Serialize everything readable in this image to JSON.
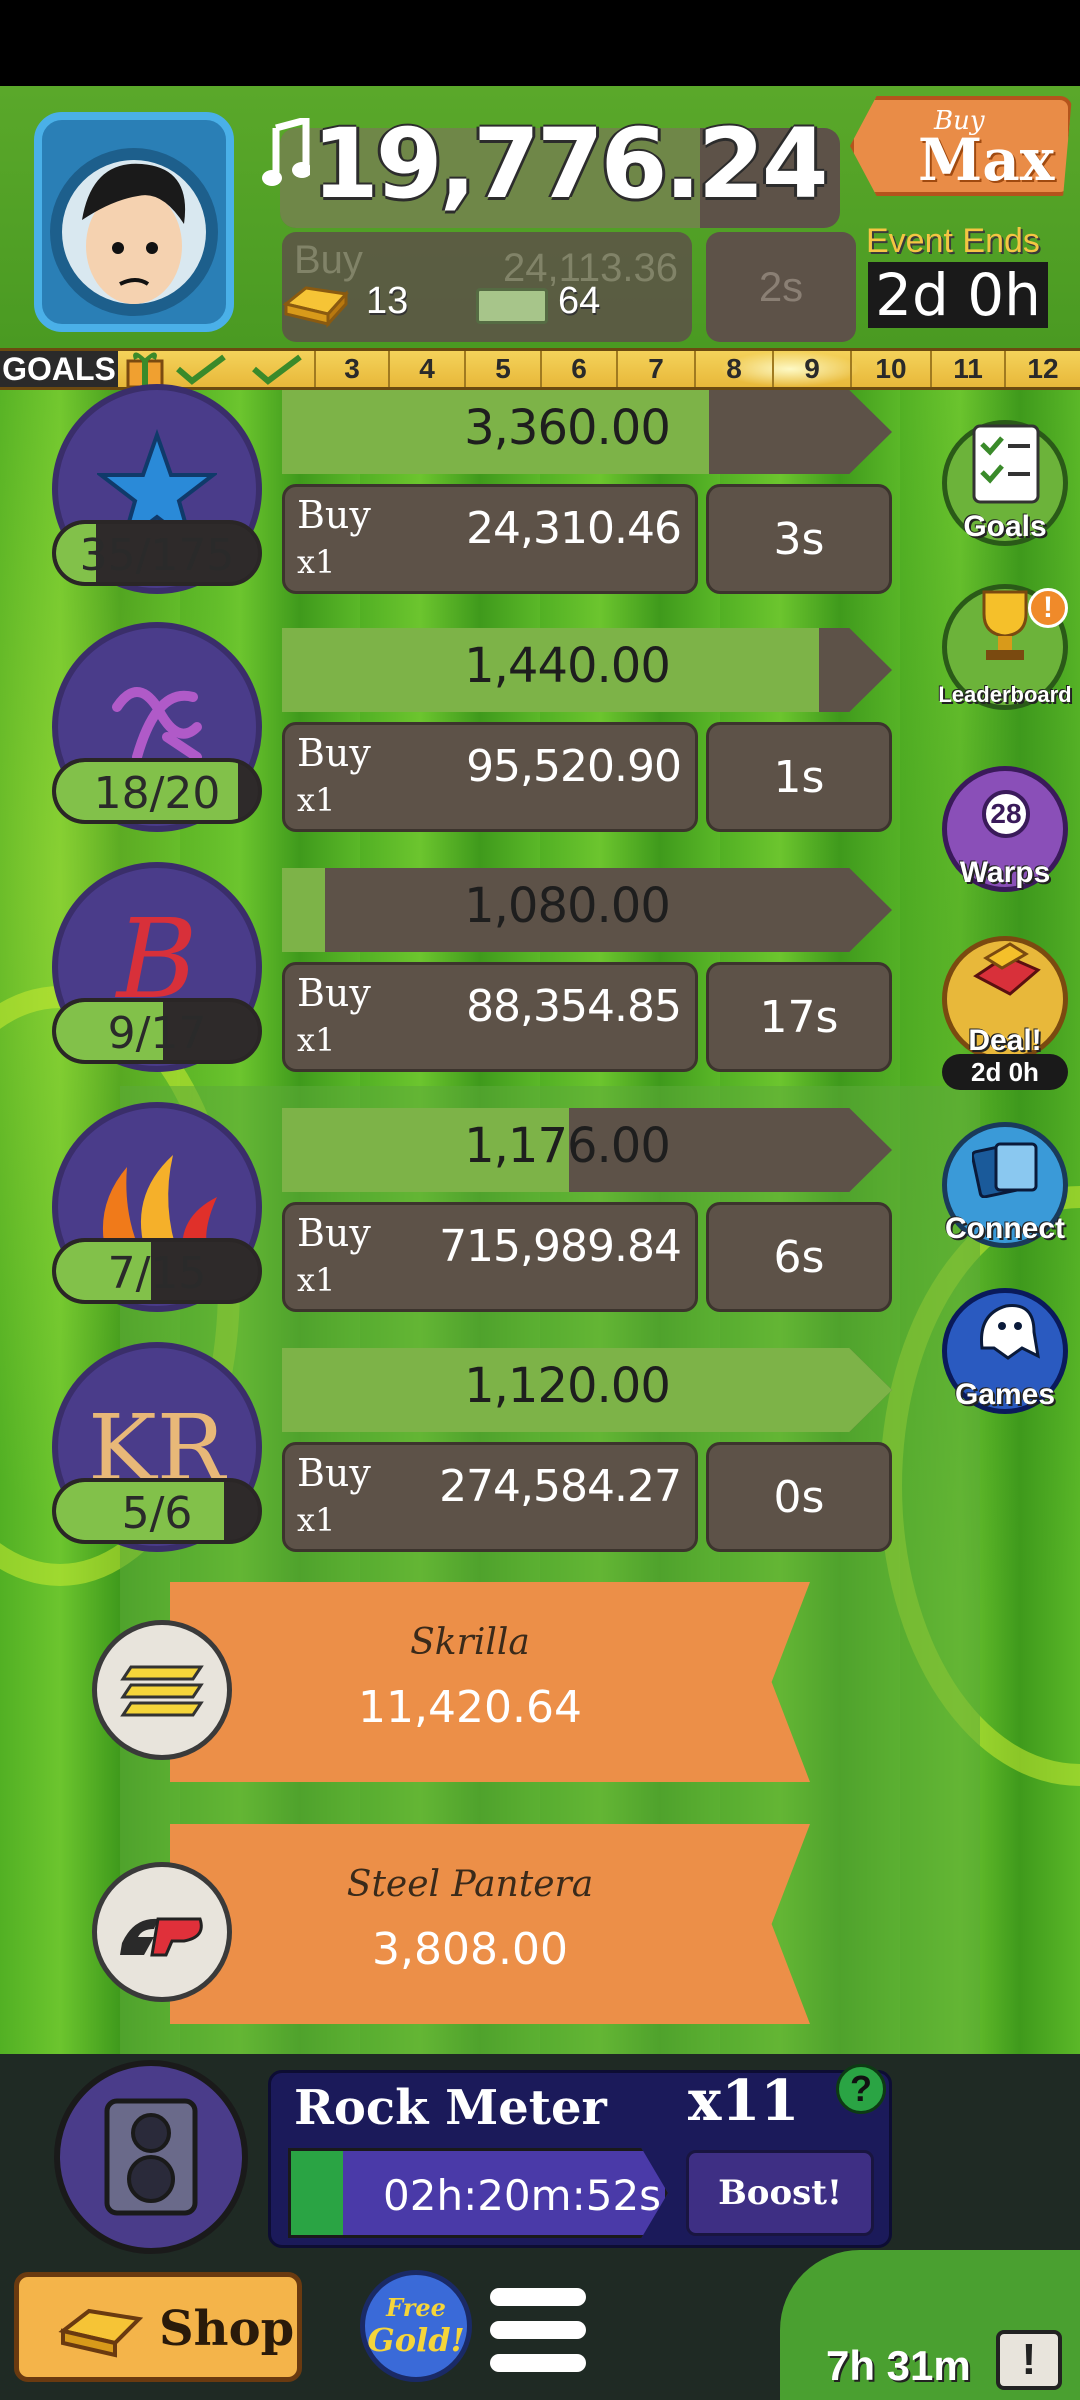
{
  "header": {
    "money": "19,776.24",
    "buy_max_small": "Buy",
    "buy_max_big": "Max",
    "gold_count": "13",
    "bill_count": "64",
    "event_label": "Event Ends in:",
    "event_time": "2d 0h",
    "ghost_buy_label": "Buy",
    "ghost_buy_cost": "24,113.36",
    "ghost_time": "2s"
  },
  "goals": {
    "label": "GOALS",
    "cells": [
      "3",
      "4",
      "5",
      "6",
      "7",
      "8",
      "9",
      "10",
      "11",
      "12"
    ]
  },
  "businesses": [
    {
      "icon": "star-icon",
      "count": "35/175",
      "count_fill": 0.2,
      "progress_value": "3,360.00",
      "progress_fill": 0.7,
      "buy_label": "Buy",
      "buy_qty": "x1",
      "cost": "24,310.46",
      "time": "3s"
    },
    {
      "icon": "curly-symbol-icon",
      "count": "18/20",
      "count_fill": 0.9,
      "progress_value": "1,440.00",
      "progress_fill": 0.88,
      "buy_label": "Buy",
      "buy_qty": "x1",
      "cost": "95,520.90",
      "time": "1s"
    },
    {
      "icon": "gothic-b-icon",
      "count": "9/17",
      "count_fill": 0.53,
      "progress_value": "1,080.00",
      "progress_fill": 0.07,
      "buy_label": "Buy",
      "buy_qty": "x1",
      "cost": "88,354.85",
      "time": "17s"
    },
    {
      "icon": "flame-icon",
      "count": "7/15",
      "count_fill": 0.47,
      "progress_value": "1,176.00",
      "progress_fill": 0.47,
      "buy_label": "Buy",
      "buy_qty": "x1",
      "cost": "715,989.84",
      "time": "6s"
    },
    {
      "icon": "kr-logo-icon",
      "count": "5/6",
      "count_fill": 0.83,
      "progress_value": "1,120.00",
      "progress_fill": 1.0,
      "buy_label": "Buy",
      "buy_qty": "x1",
      "cost": "274,584.27",
      "time": "0s"
    }
  ],
  "side_buttons": [
    {
      "label": "Goals",
      "icon": "checklist-icon",
      "color": "#6cb33a"
    },
    {
      "label": "Leaderboard",
      "icon": "trophy-icon",
      "color": "#6cb33a"
    },
    {
      "label": "Warps",
      "icon": "warp-icon",
      "color": "#8a4fb8",
      "badge": "28"
    },
    {
      "label": "Deal!",
      "icon": "gift-icon",
      "color": "#e8b83a",
      "sub": "2d 0h"
    },
    {
      "label": "Connect",
      "icon": "cards-icon",
      "color": "#3a9ad8"
    },
    {
      "label": "Games",
      "icon": "ghost-icon",
      "color": "#2a5ac0"
    }
  ],
  "managers": [
    {
      "name": "Skrilla",
      "cost": "11,420.64",
      "icon": "stacked-bars-icon"
    },
    {
      "name": "Steel Pantera",
      "cost": "3,808.00",
      "icon": "sp-logo-icon"
    }
  ],
  "rock_meter": {
    "title": "Rock Meter",
    "multiplier": "x11",
    "help": "?",
    "timer": "02h:20m:52s",
    "fill": 0.14,
    "boost_label": "Boost!"
  },
  "bottom": {
    "shop_label": "Shop",
    "free_gold_1": "Free",
    "free_gold_2": "Gold!",
    "timer": "7h 31m",
    "alert": "!"
  }
}
